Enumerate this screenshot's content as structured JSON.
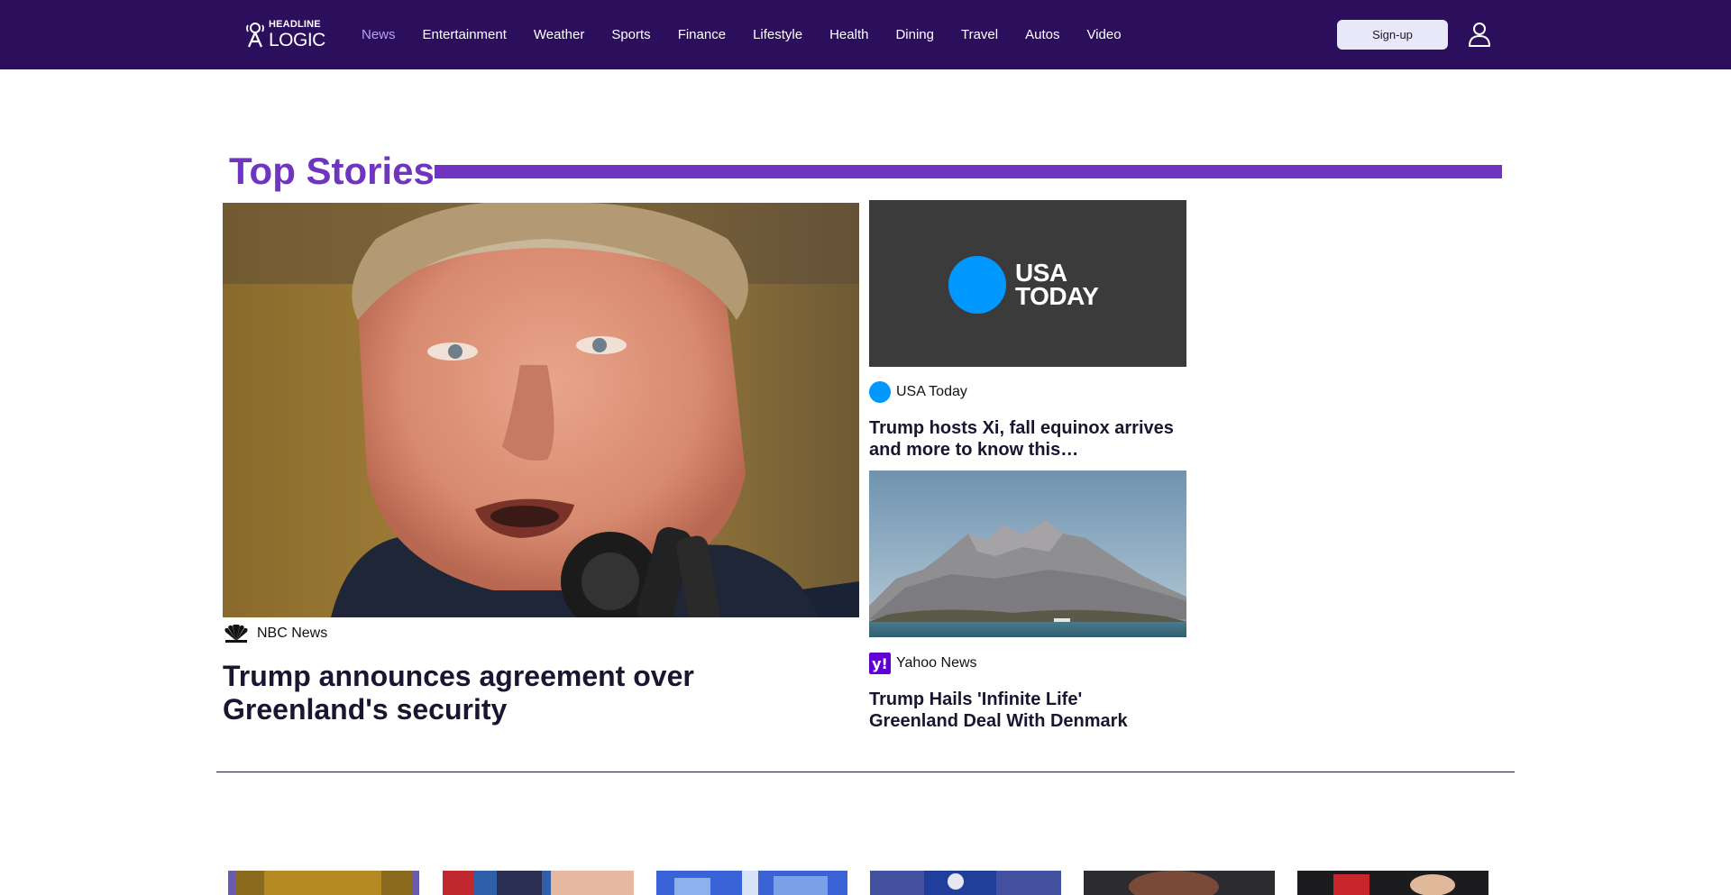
{
  "header": {
    "logo_top": "HEADLINE",
    "logo_bottom": "LOGIC",
    "nav": [
      {
        "label": "News",
        "active": true
      },
      {
        "label": "Entertainment"
      },
      {
        "label": "Weather"
      },
      {
        "label": "Sports"
      },
      {
        "label": "Finance"
      },
      {
        "label": "Lifestyle"
      },
      {
        "label": "Health"
      },
      {
        "label": "Dining"
      },
      {
        "label": "Travel"
      },
      {
        "label": "Autos"
      },
      {
        "label": "Video"
      }
    ],
    "signup_label": "Sign-up",
    "user_icon": "user-icon"
  },
  "section": {
    "title": "Top Stories"
  },
  "main_story": {
    "source": "NBC News",
    "source_icon": "nbc-peacock-icon",
    "headline": "Trump announces agreement over Greenland's security"
  },
  "side_stories": [
    {
      "image_text_1": "USA",
      "image_text_2": "TODAY",
      "source": "USA Today",
      "source_icon": "usa-today-icon",
      "headline": "Trump hosts Xi, fall equinox arrives and more to know this…"
    },
    {
      "source": "Yahoo News",
      "source_icon": "yahoo-icon",
      "source_icon_glyph": "y!",
      "headline": "Trump Hails 'Infinite Life' Greenland Deal With Denmark"
    }
  ],
  "colors": {
    "header_bg": "#2b0f5c",
    "accent": "#6f34c0",
    "nav_active": "#b6a2ef",
    "usa_today_blue": "#0098ff",
    "yahoo_purple": "#6001d2"
  }
}
